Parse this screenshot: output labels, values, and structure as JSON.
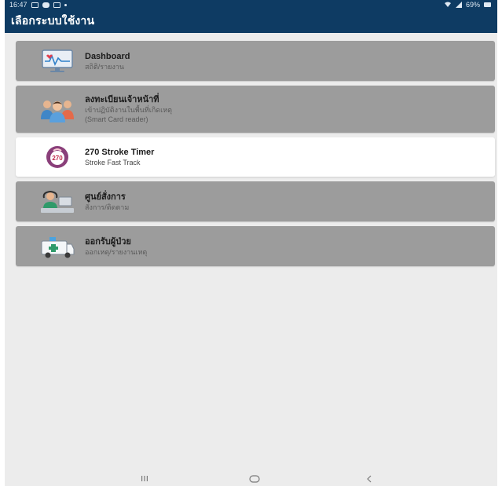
{
  "status_bar": {
    "time": "16:47",
    "battery": "69%"
  },
  "app_bar": {
    "title": "เลือกระบบใช้งาน"
  },
  "menu": [
    {
      "title": "Dashboard",
      "subtitle": "สถิติ/รายงาน",
      "icon": "monitor-chart-icon"
    },
    {
      "title": "ลงทะเบียนเจ้าหน้าที่",
      "subtitle": "เข้าปฏิบัติงานในพื้นที่เกิดเหตุ",
      "subtitle2": "(Smart Card reader)",
      "icon": "staff-group-icon"
    },
    {
      "title": "270 Stroke Timer",
      "subtitle": "Stroke Fast Track",
      "icon": "stroke-timer-icon",
      "badge": "270"
    },
    {
      "title": "ศูนย์สั่งการ",
      "subtitle": "สั่งการ/ติดตาม",
      "icon": "command-center-icon"
    },
    {
      "title": "ออกรับผู้ป่วย",
      "subtitle": "ออกเหตุ/รายงานเหตุ",
      "icon": "ambulance-icon"
    }
  ],
  "nav_bar": {
    "recents": "recents-icon",
    "home": "home-icon",
    "back": "back-icon"
  },
  "colors": {
    "header": "#0e3b63",
    "card": "#9c9c9c",
    "active_card": "#ffffff",
    "badge": "#8a3f7a"
  }
}
